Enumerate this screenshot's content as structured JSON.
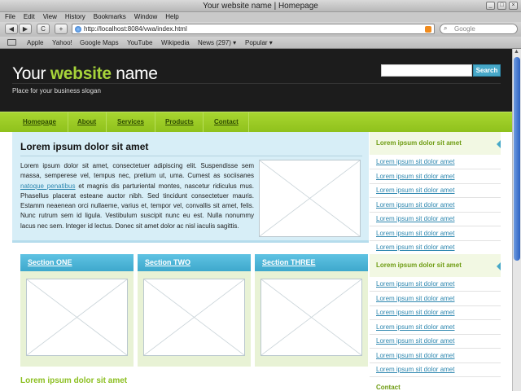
{
  "browser": {
    "window_title": "Your website name | Homepage",
    "window_buttons": [
      "_",
      "□",
      "×"
    ],
    "menu": [
      "File",
      "Edit",
      "View",
      "History",
      "Bookmarks",
      "Window",
      "Help"
    ],
    "nav_buttons": {
      "back": "◀",
      "forward": "▶",
      "reload": "C",
      "add": "+"
    },
    "url": "http://localhost:8084/vwa/index.html",
    "search_placeholder": "Google",
    "bookmarks": [
      "Apple",
      "Yahoo!",
      "Google Maps",
      "YouTube",
      "Wikipedia",
      "News (297) ▾",
      "Popular ▾"
    ]
  },
  "site": {
    "title_start": "Your ",
    "title_accent": "website",
    "title_end": " name",
    "slogan": "Place for your business slogan",
    "search_button": "Search",
    "nav": [
      "Homepage",
      "About",
      "Services",
      "Products",
      "Contact"
    ],
    "main_title": "Lorem ipsum dolor sit amet",
    "main_body_before": "Lorem ipsum dolor sit amet, consectetuer adipiscing elit. Suspendisse sem massa, semperese vel, tempus nec, pretium ut, uma. Cumest as sociisanes ",
    "main_body_link": "natoque penatibus",
    "main_body_after": " et magnis dis parturiental montes, nascetur ridiculus mus. Phasellus placerat esteane auctor nibh. Sed tincidunt consectetuer mauris. Estamm neaenean orci nullaeme, varius et, tempor vel, convallis sit amet, felis. Nunc rutrum sem id ligula. Vestibulum suscipit nunc eu est. Nulla nonummy lacus nec sem. Integer id lectus. Donec sit amet dolor ac nisl iaculis sagittis.",
    "sections": [
      "Section ONE",
      "Section TWO",
      "Section THREE"
    ],
    "lower_title": "Lorem ipsum dolor sit amet",
    "sidebar": {
      "group1_title": "Lorem ipsum dolor sit amet",
      "group1_links": [
        "Lorem ipsum sit dolor amet",
        "Lorem ipsum sit dolor amet",
        "Lorem ipsum sit dolor amet",
        "Lorem ipsum sit dolor amet",
        "Lorem ipsum sit dolor amet",
        "Lorem ipsum sit dolor amet",
        "Lorem ipsum sit dolor amet"
      ],
      "group2_title": "Lorem ipsum dolor sit amet",
      "group2_links": [
        "Lorem ipsum sit dolor amet",
        "Lorem ipsum sit dolor amet",
        "Lorem ipsum sit dolor amet",
        "Lorem ipsum sit dolor amet",
        "Lorem ipsum sit dolor amet",
        "Lorem ipsum sit dolor amet",
        "Lorem ipsum sit dolor amet"
      ],
      "contact": "Contact"
    }
  },
  "colors": {
    "accent_green": "#a6d33a",
    "link_blue": "#2f88b0",
    "header_dark": "#1c1c1c"
  }
}
